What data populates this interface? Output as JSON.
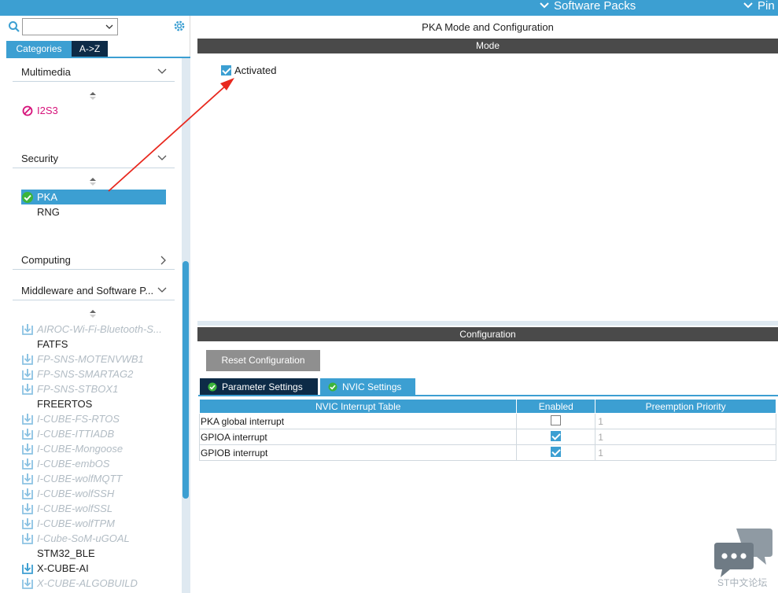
{
  "topbar": {
    "software_packs": "Software Packs",
    "pinout": "Pin"
  },
  "sidebar": {
    "search_value": "",
    "tabs": {
      "categories": "Categories",
      "az": "A->Z"
    },
    "categories": [
      {
        "label": "Multimedia",
        "state": "expanded"
      },
      {
        "label": "Security",
        "state": "expanded"
      },
      {
        "label": "Computing",
        "state": "collapsed"
      },
      {
        "label": "Middleware and Software P...",
        "state": "expanded"
      }
    ],
    "multimedia_items": [
      {
        "label": "I2S3",
        "status": "error"
      }
    ],
    "security_items": [
      {
        "label": "PKA",
        "status": "ok",
        "selected": true
      },
      {
        "label": "RNG",
        "status": "none"
      }
    ],
    "middleware_items": [
      {
        "label": "AIROC-Wi-Fi-Bluetooth-S...",
        "icon": "download-icon",
        "disabled": true
      },
      {
        "label": "FATFS",
        "icon": "none",
        "disabled": false
      },
      {
        "label": "FP-SNS-MOTENVWB1",
        "icon": "download-icon",
        "disabled": true
      },
      {
        "label": "FP-SNS-SMARTAG2",
        "icon": "download-icon",
        "disabled": true
      },
      {
        "label": "FP-SNS-STBOX1",
        "icon": "download-icon",
        "disabled": true
      },
      {
        "label": "FREERTOS",
        "icon": "none",
        "disabled": false
      },
      {
        "label": "I-CUBE-FS-RTOS",
        "icon": "download-icon",
        "disabled": true
      },
      {
        "label": "I-CUBE-ITTIADB",
        "icon": "download-icon",
        "disabled": true
      },
      {
        "label": "I-CUBE-Mongoose",
        "icon": "download-icon",
        "disabled": true
      },
      {
        "label": "I-CUBE-embOS",
        "icon": "download-icon",
        "disabled": true
      },
      {
        "label": "I-CUBE-wolfMQTT",
        "icon": "download-icon",
        "disabled": true
      },
      {
        "label": "I-CUBE-wolfSSH",
        "icon": "download-icon",
        "disabled": true
      },
      {
        "label": "I-CUBE-wolfSSL",
        "icon": "download-icon",
        "disabled": true
      },
      {
        "label": "I-CUBE-wolfTPM",
        "icon": "download-icon",
        "disabled": true
      },
      {
        "label": "I-Cube-SoM-uGOAL",
        "icon": "download-icon",
        "disabled": true
      },
      {
        "label": "STM32_BLE",
        "icon": "none",
        "disabled": false
      },
      {
        "label": "X-CUBE-AI",
        "icon": "download-icon",
        "disabled": false
      },
      {
        "label": "X-CUBE-ALGOBUILD",
        "icon": "download-icon",
        "disabled": true
      }
    ]
  },
  "main": {
    "title": "PKA Mode and Configuration",
    "mode_header": "Mode",
    "activated_label": "Activated",
    "activated_checked": true,
    "config_header": "Configuration",
    "reset_button": "Reset Configuration",
    "tabs": {
      "parameter": "Parameter Settings",
      "nvic": "NVIC Settings"
    },
    "nvic_table": {
      "headers": [
        "NVIC Interrupt Table",
        "Enabled",
        "Preemption Priority"
      ],
      "rows": [
        {
          "name": "PKA global interrupt",
          "enabled": false,
          "priority": "1"
        },
        {
          "name": "GPIOA interrupt",
          "enabled": true,
          "priority": "1"
        },
        {
          "name": "GPIOB interrupt",
          "enabled": true,
          "priority": "1"
        }
      ]
    }
  },
  "watermark": {
    "text": "ST中文论坛"
  },
  "colors": {
    "accent": "#3c9fd2",
    "dark_tab": "#0d2b47",
    "section_bar": "#4a4a4a",
    "error_pink": "#d6127a",
    "ok_green": "#3cb43c",
    "annotation_red": "#e8281e"
  }
}
